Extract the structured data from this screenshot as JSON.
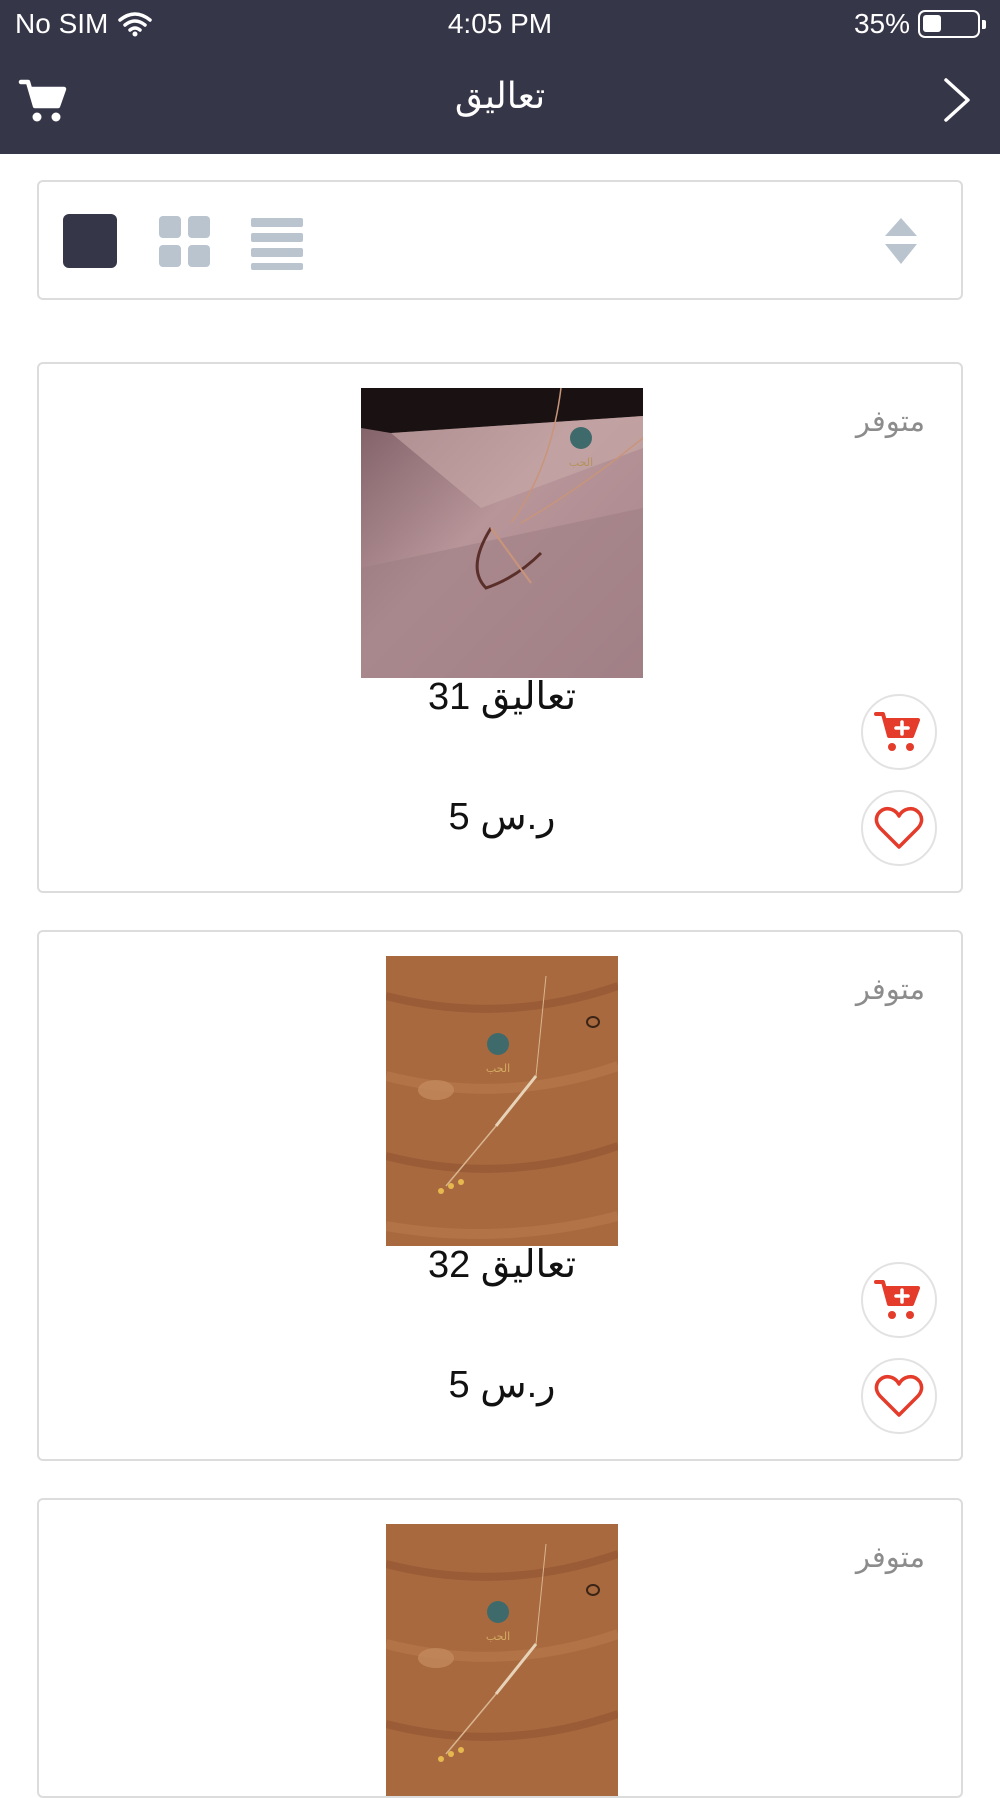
{
  "status_bar": {
    "carrier": "No SIM",
    "time": "4:05 PM",
    "battery": "35%"
  },
  "nav": {
    "title": "تعاليق",
    "cart_icon": "cart-icon",
    "back_icon": "chevron-right-icon"
  },
  "toolbar": {
    "views": [
      "single-column",
      "grid",
      "list"
    ],
    "active_view": "single-column",
    "sort_icon": "sort-icon"
  },
  "colors": {
    "header_bg": "#363649",
    "accent_red": "#e53b2a",
    "muted_icon": "#b9c4cf"
  },
  "products": [
    {
      "stock": "متوفر",
      "name": "تعاليق 31",
      "price": "5 ر.س"
    },
    {
      "stock": "متوفر",
      "name": "تعاليق 32",
      "price": "5 ر.س"
    },
    {
      "stock": "متوفر",
      "name": "",
      "price": ""
    }
  ]
}
